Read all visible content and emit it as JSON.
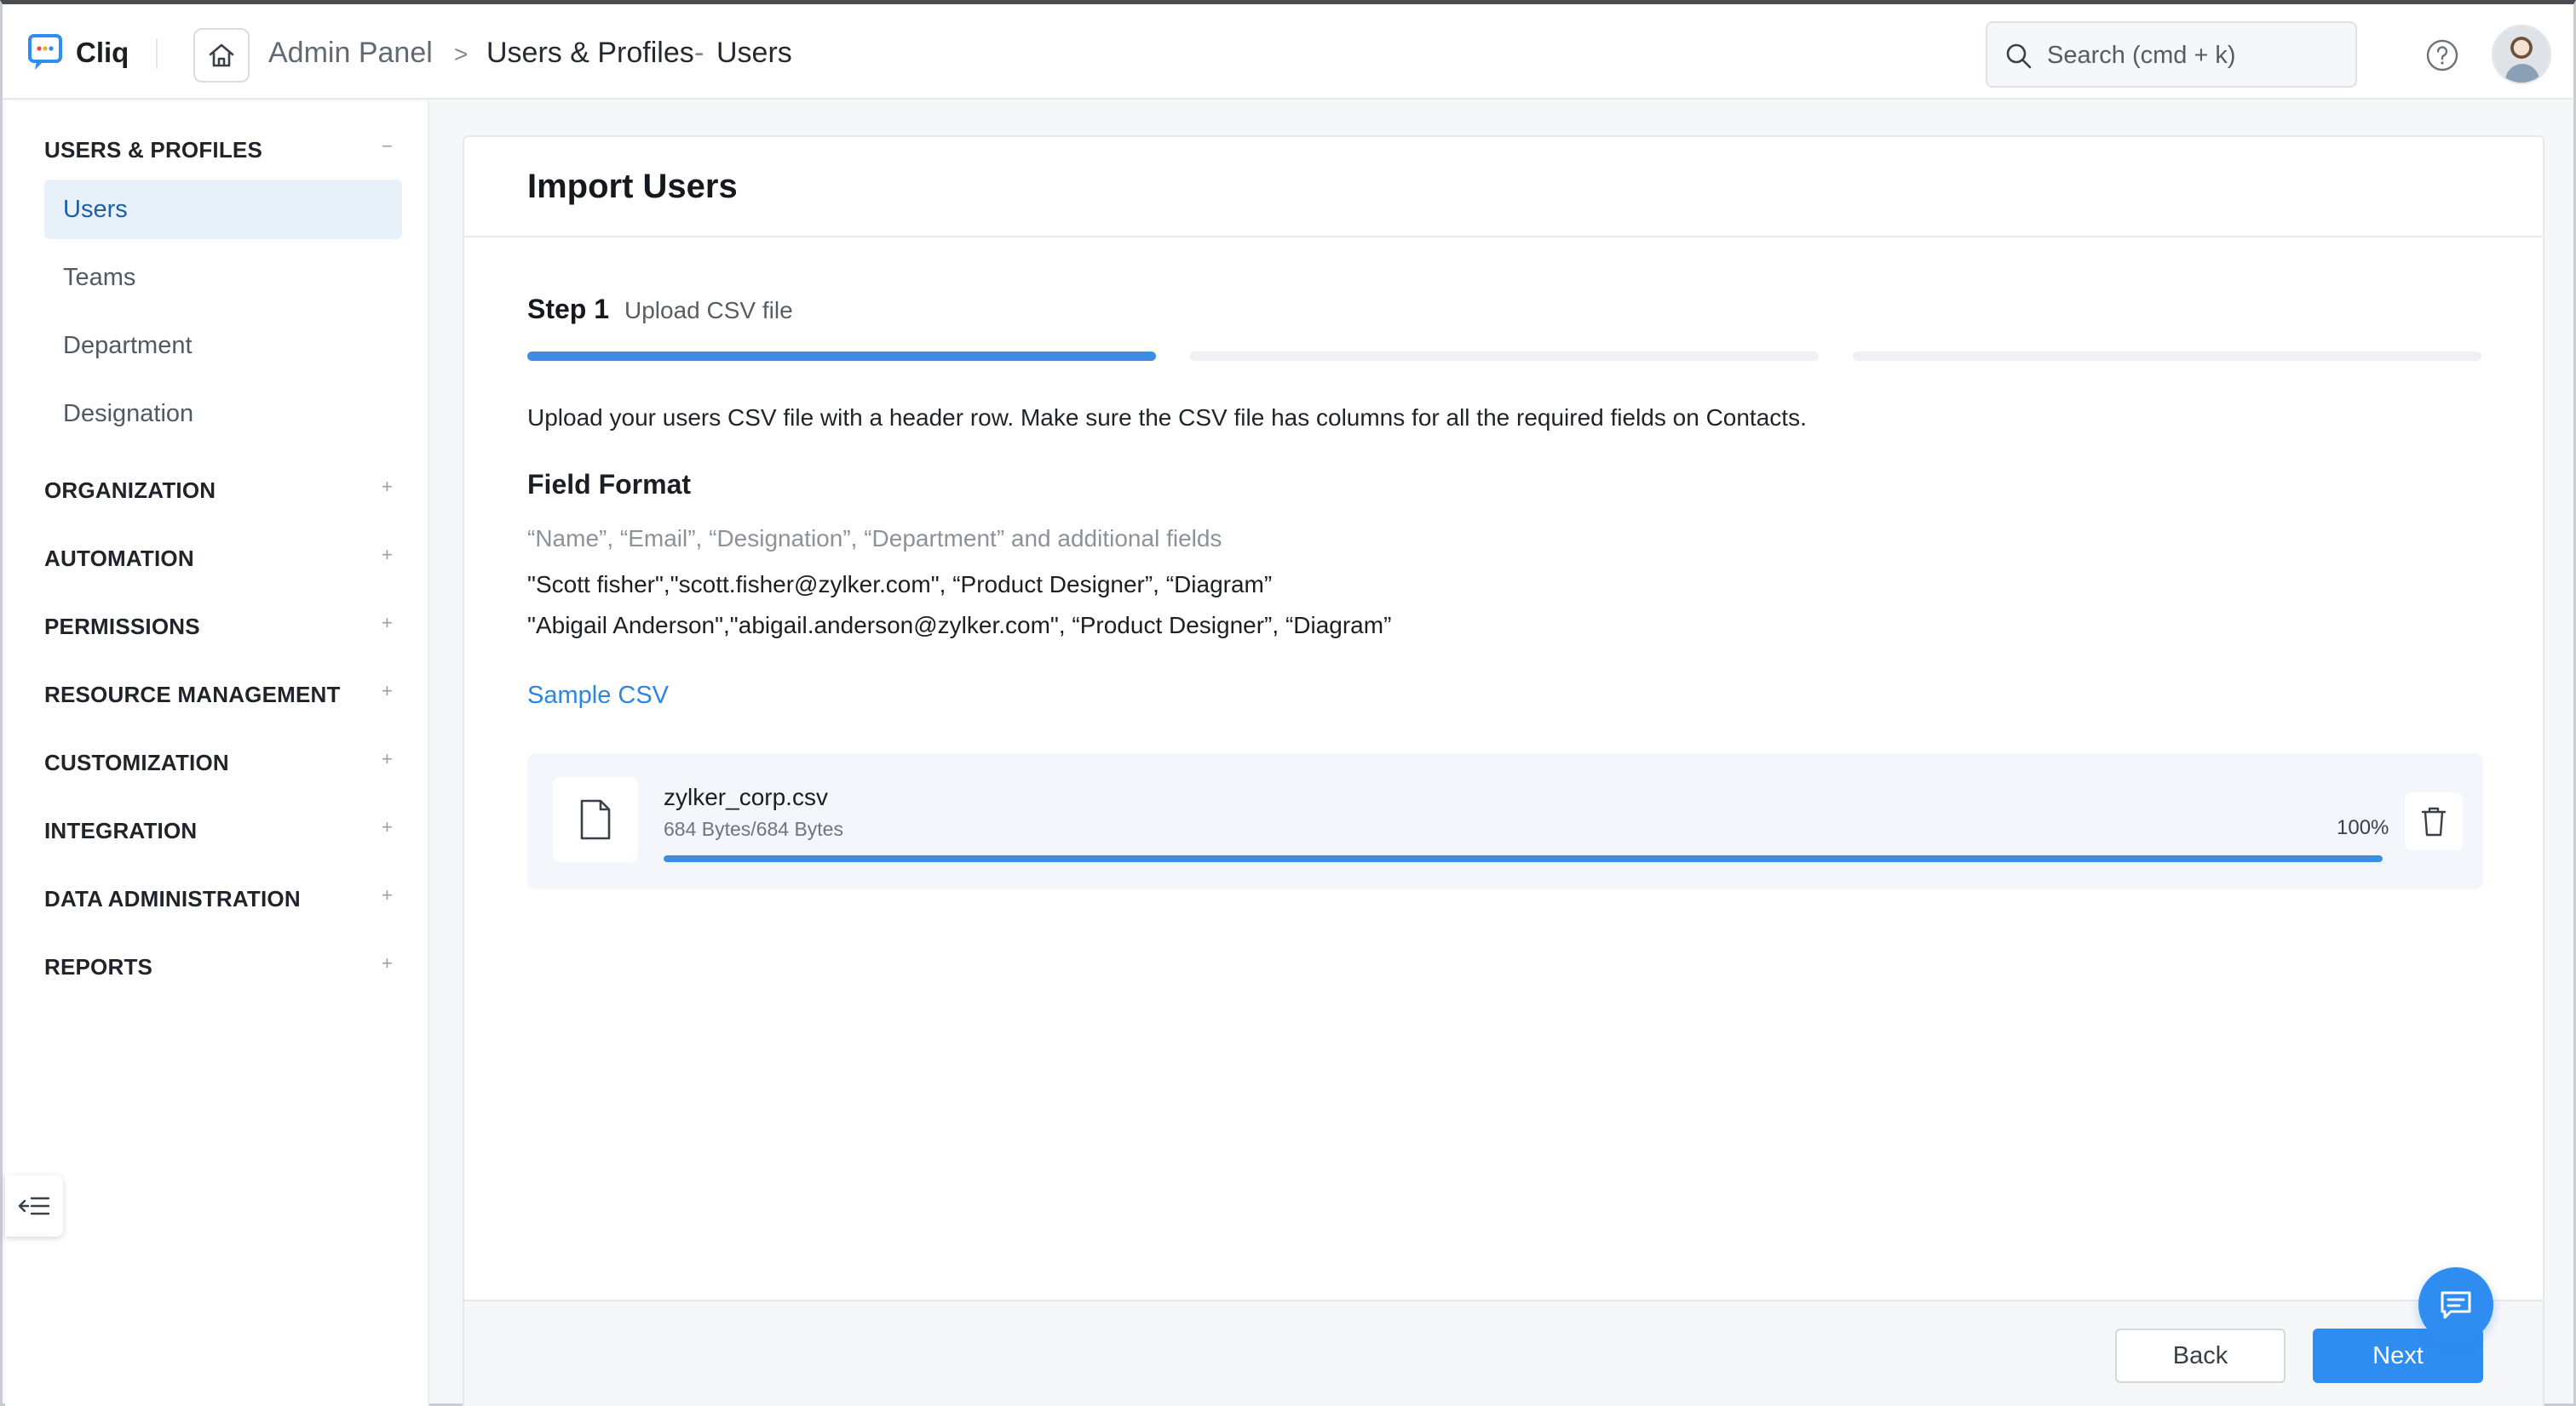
{
  "header": {
    "app_name": "Cliq",
    "breadcrumb": {
      "root": "Admin Panel",
      "separator": ">",
      "section": "Users & Profiles",
      "dash": "-",
      "page": "Users"
    },
    "search_placeholder": "Search (cmd + k)"
  },
  "sidebar": {
    "groups": [
      {
        "label": "USERS & PROFILES",
        "toggle": "−",
        "items": [
          "Users",
          "Teams",
          "Department",
          "Designation"
        ],
        "active_item": "Users"
      },
      {
        "label": "ORGANIZATION",
        "toggle": "+"
      },
      {
        "label": "AUTOMATION",
        "toggle": "+"
      },
      {
        "label": "PERMISSIONS",
        "toggle": "+"
      },
      {
        "label": "RESOURCE MANAGEMENT",
        "toggle": "+"
      },
      {
        "label": "CUSTOMIZATION",
        "toggle": "+"
      },
      {
        "label": "INTEGRATION",
        "toggle": "+"
      },
      {
        "label": "DATA ADMINISTRATION",
        "toggle": "+"
      },
      {
        "label": "REPORTS",
        "toggle": "+"
      }
    ]
  },
  "main": {
    "title": "Import Users",
    "step": {
      "label": "Step 1",
      "description": "Upload CSV file",
      "current": 1,
      "total": 3
    },
    "intro": "Upload your users CSV file with a header row. Make sure the CSV file has columns for all the required fields on Contacts.",
    "field_format": {
      "title": "Field Format",
      "header": "“Name”, “Email”, “Designation”, “Department” and additional fields",
      "rows": [
        "\"Scott fisher\",\"scott.fisher@zylker.com\", “Product Designer”, “Diagram”",
        "\"Abigail Anderson\",\"abigail.anderson@zylker.com\", “Product Designer”, “Diagram”"
      ]
    },
    "sample_link": "Sample CSV",
    "file": {
      "name": "zylker_corp.csv",
      "size": "684 Bytes/684 Bytes",
      "progress_label": "100%",
      "progress": 1.0
    },
    "buttons": {
      "back": "Back",
      "next": "Next"
    }
  },
  "colors": {
    "accent": "#2f8cf0",
    "active_nav_bg": "#e8f0f9",
    "active_nav_text": "#1d5fa9"
  }
}
